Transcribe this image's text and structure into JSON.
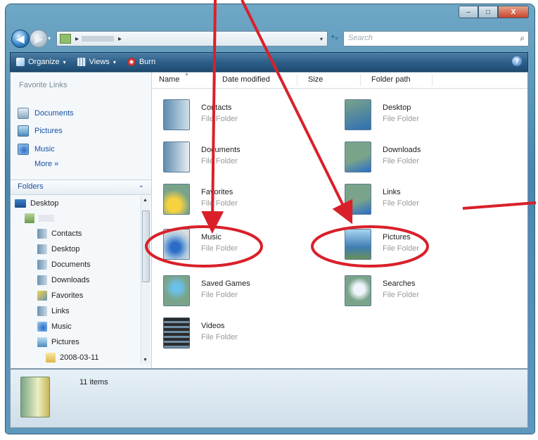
{
  "window": {
    "controls": {
      "minimize": "–",
      "maximize": "□",
      "close": "X"
    }
  },
  "nav": {
    "back_icon": "back-arrow-icon",
    "forward_icon": "forward-arrow-icon",
    "address_separator": "▸",
    "address_dropdown": "▾",
    "refresh": "⁺⁴",
    "search_placeholder": "Search"
  },
  "toolbar": {
    "organize": "Organize",
    "views": "Views",
    "burn": "Burn",
    "help": "?"
  },
  "sidebar": {
    "favorites_title": "Favorite Links",
    "favorites": [
      {
        "label": "Documents",
        "icon": "documents-icon"
      },
      {
        "label": "Pictures",
        "icon": "pictures-icon"
      },
      {
        "label": "Music",
        "icon": "music-icon"
      }
    ],
    "more": "More »",
    "folders_title": "Folders",
    "folders_chevron": "⌄",
    "tree": [
      {
        "label": "Desktop"
      },
      {
        "label": ""
      },
      {
        "label": "Contacts"
      },
      {
        "label": "Desktop"
      },
      {
        "label": "Documents"
      },
      {
        "label": "Downloads"
      },
      {
        "label": "Favorites"
      },
      {
        "label": "Links"
      },
      {
        "label": "Music"
      },
      {
        "label": "Pictures"
      },
      {
        "label": "2008-03-11"
      }
    ]
  },
  "columns": {
    "name": "Name",
    "date_modified": "Date modified",
    "size": "Size",
    "folder_path": "Folder path"
  },
  "items": [
    {
      "name": "Contacts",
      "type": "File Folder"
    },
    {
      "name": "Desktop",
      "type": "File Folder"
    },
    {
      "name": "Documents",
      "type": "File Folder"
    },
    {
      "name": "Downloads",
      "type": "File Folder"
    },
    {
      "name": "Favorites",
      "type": "File Folder"
    },
    {
      "name": "Links",
      "type": "File Folder"
    },
    {
      "name": "Music",
      "type": "File Folder"
    },
    {
      "name": "Pictures",
      "type": "File Folder"
    },
    {
      "name": "Saved Games",
      "type": "File Folder"
    },
    {
      "name": "Searches",
      "type": "File Folder"
    },
    {
      "name": "Videos",
      "type": "File Folder"
    }
  ],
  "status": {
    "count": "11 items"
  },
  "annotation": {
    "arrow_color": "#d9202a"
  }
}
